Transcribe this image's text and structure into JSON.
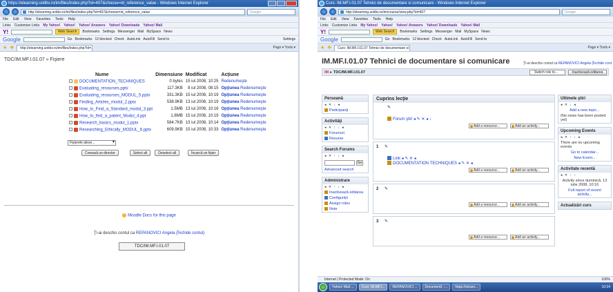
{
  "win1": {
    "title": "https://elearning.unitbv.ro/im/files/index.php?id=407&choose=id_reference_value - Windows Internet Explorer",
    "address": "http://elearning.unitbv.ro/im/files/index.php?id=407&choose=id_reference_value",
    "search_placeholder": "Google",
    "menu": [
      "File",
      "Edit",
      "View",
      "Favorites",
      "Tools",
      "Help"
    ],
    "links": [
      "Links",
      "Customize Links",
      "My Yahoo!",
      "Yahoo!",
      "Yahoo! Answers",
      "Yahoo! Downloads",
      "Yahoo! Mail"
    ],
    "yahoo": {
      "logo": "Y!",
      "web_search": "Web Search",
      "items": [
        "Bookmarks",
        "Settings",
        "Messenger",
        "Mail",
        "MySpace",
        "News"
      ]
    },
    "google": {
      "logo": "Google",
      "items": [
        "Go",
        "Bookmarks",
        "12 blocked",
        "Check",
        "AutoLink",
        "AutoFill",
        "Send to"
      ],
      "settings": "Settings"
    },
    "tab": "http://elearning.unitbv.ro/im/files/index.php?id=...",
    "tabtools": "Page ▾  Tools ▾",
    "breadcrumb": "TDC/IM.MF.I.01.07 » Fişiere",
    "columns": {
      "name": "Nume",
      "size": "Dimensiune",
      "modified": "Modificat",
      "action": "Acţiune"
    },
    "files": [
      {
        "name": "DOCUMENTATION_TECHNIQUES",
        "type": "folder",
        "size": "0 bytes",
        "modified": "15 iul 2008, 10:25",
        "opt": "",
        "rename": "Redenumeşte"
      },
      {
        "name": "Evaluating_resourses.pptx",
        "type": "ppt",
        "size": "117.3KB",
        "modified": "8 iul 2008, 08:15",
        "opt": "Opţiunea",
        "rename": "Redenumeşte"
      },
      {
        "name": "Evaluating_resourses_MODUL_5.pptx",
        "type": "ppt",
        "size": "331.3KB",
        "modified": "15 iul 2008, 10:19",
        "opt": "Opţiunea",
        "rename": "Redenumeşte"
      },
      {
        "name": "Finding_Articles_modul_2.pptx",
        "type": "ppt",
        "size": "538.9KB",
        "modified": "13 iul 2008, 10:19",
        "opt": "Opţiunea",
        "rename": "Redenumeşte"
      },
      {
        "name": "How_to_Find_a_Standard_modul_3.ppt",
        "type": "ppt",
        "size": "1.5MB",
        "modified": "13 iul 2008, 10:16",
        "opt": "Opţiunea",
        "rename": "Redenumeşte"
      },
      {
        "name": "How_to_find_a_patent_Modul_4.ppt",
        "type": "ppt",
        "size": "1.8MB",
        "modified": "15 iul 2008, 10:19",
        "opt": "Opţiunea",
        "rename": "Redenumeşte"
      },
      {
        "name": "Research_basics_modul_1.pptx",
        "type": "ppt",
        "size": "584.7KB",
        "modified": "13 iul 2008, 10:14",
        "opt": "Opţiunea",
        "rename": "Redenumeşte"
      },
      {
        "name": "Researching_Ethically_MODUL_6.pptx",
        "type": "ppt",
        "size": "609.9KB",
        "modified": "15 iul 2008, 10:33",
        "opt": "Opţiunea",
        "rename": "Redenumeşte"
      }
    ],
    "with_selected": "Fişierele alese...",
    "buttons": {
      "create_dir": "Creează un director",
      "select_all": "Select all",
      "deselect_all": "Deselect all",
      "upload": "Încarcă un fişier"
    },
    "moodle_docs": "Moodle Docs for this page",
    "logged_in_prefix": "Ţi-ai deschis contul ca ",
    "logged_in_user": "REPANOVICI Angela",
    "logged_in_suffix": " (Închide contul)",
    "footer_course": "TDC/IM.MF.I.01.07"
  },
  "win2": {
    "title": "Curs: IM.MF.I.01.07 Tehnici de documentare si comunicare - Windows Internet Explorer",
    "address": "http://elearning.unitbv.ro/im/course/view.php?id=407",
    "search_placeholder": "Google",
    "tab": "Curs: IM.MF.I.01.07 Tehnici de documentare si co...",
    "course_title": "IM.MF.I.01.07 Tehnici de documentare si comunicare",
    "logged_in_prefix": "Ţi-ai deschis contul ca ",
    "logged_in_user": "REPANOVICI Angela",
    "logged_in_suffix": " (Închide cont",
    "nav": {
      "home": "IM",
      "sep": "▸",
      "course": "TDC/IM.MF.I.01.07"
    },
    "switch_role": "Switch role to...",
    "edit_button": "Inactivează editarea",
    "left_blocks": {
      "persons": {
        "title": "Persoană",
        "icons": "◂ ✕ ↓ ◂",
        "items": [
          "Participanţi"
        ]
      },
      "activities": {
        "title": "Activităţi",
        "icons": "◂ ✕ ↑ ↓ ◂",
        "items": [
          "Forumuri",
          "Resurse"
        ]
      },
      "search": {
        "title": "Search Forums",
        "icons": "◂ ✕ ↑ ↓ ◂",
        "go": "Go",
        "advanced": "Advanced search"
      },
      "admin": {
        "title": "Administrare",
        "icons": "◂ ✕ ↑ ↓ ◂",
        "items": [
          "Inactivează editarea",
          "Configurări",
          "Assign roles",
          "Note"
        ]
      }
    },
    "sections": {
      "header": "Cuprins lecţie",
      "s0": {
        "act": "Forum ştiri  ◂ ✎ ✕ ◂ ↓"
      },
      "s1": {
        "num": "1",
        "acts": [
          "Link  ◂ ✎ ✕ ◂",
          "DOCUMENTATION TECHNIQUES  ◂ ✎ ✕ ◂"
        ]
      },
      "s2": {
        "num": "2"
      },
      "s3": {
        "num": "3"
      },
      "add_resource": "Add a resource...",
      "add_activity": "Add an activity..."
    },
    "right_blocks": {
      "news": {
        "title": "Ultimele ştiri",
        "icons": "◂ ✕ ↓ ◂",
        "add": "Add a new topic...",
        "none": "(No news has been posted yet)"
      },
      "events": {
        "title": "Upcoming Events",
        "icons": "◂ ✕ ↑ ↓ ◂",
        "none": "There are no upcoming events",
        "goto": "Go to calendar...",
        "new": "New Event..."
      },
      "recent": {
        "title": "Activitate recentă",
        "icons": "◂ ✕ ↑ ↓",
        "since": "Activity since duminică, 13 iulie 2008, 10:16",
        "full": "Full report of recent activity..."
      },
      "updates": {
        "title": "Actualizări curs"
      }
    },
    "status": "Internet | Protected Mode: On",
    "zoom": "100%"
  },
  "taskbar": {
    "tasks": [
      "Yahoo! Mail ...",
      "Curs: IM.MF.I...",
      "REPANOVICI ...",
      "Document1 -...",
      "https://elearn..."
    ],
    "clock": "10:34"
  }
}
